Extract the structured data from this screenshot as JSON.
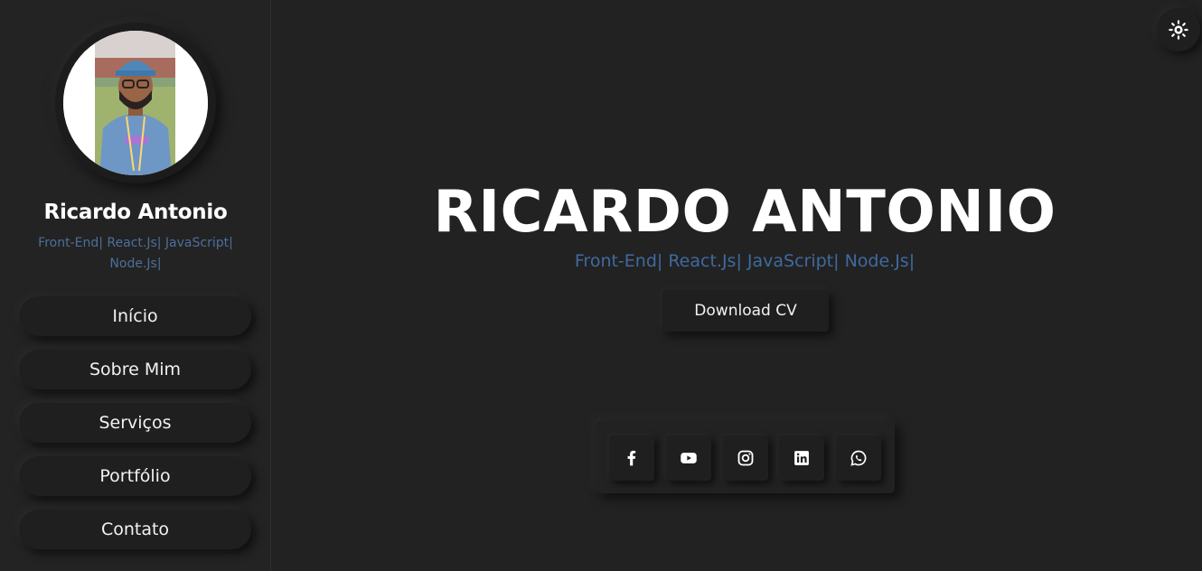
{
  "sidebar": {
    "name": "Ricardo Antonio",
    "role": "Front-End| React.Js| JavaScript| Node.Js|",
    "nav": [
      {
        "label": "Início"
      },
      {
        "label": "Sobre Mim"
      },
      {
        "label": "Serviços"
      },
      {
        "label": "Portfólio"
      },
      {
        "label": "Contato"
      }
    ]
  },
  "hero": {
    "title": "RICARDO ANTONIO",
    "role": "Front-End| React.Js| JavaScript| Node.Js|",
    "download_label": "Download CV"
  },
  "social": [
    {
      "icon": "facebook-icon"
    },
    {
      "icon": "youtube-icon"
    },
    {
      "icon": "instagram-icon"
    },
    {
      "icon": "linkedin-icon"
    },
    {
      "icon": "whatsapp-icon"
    }
  ],
  "theme_toggle": {
    "icon": "sun-icon"
  },
  "colors": {
    "background": "#222222",
    "accent_text": "#3f6aa0",
    "text": "#ffffff"
  }
}
